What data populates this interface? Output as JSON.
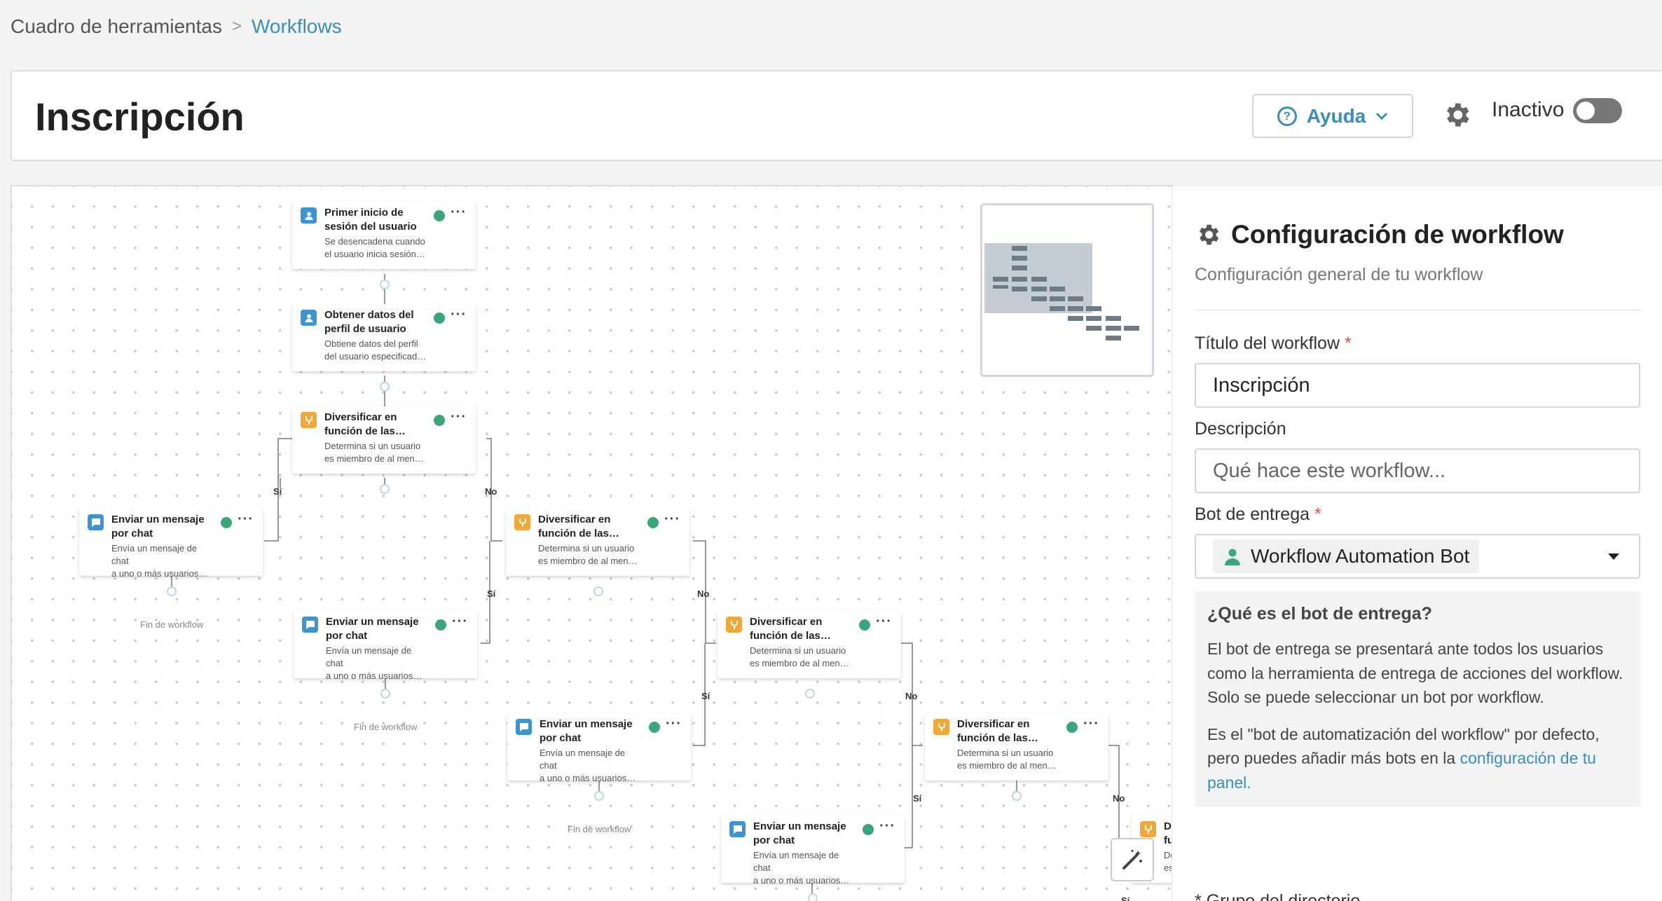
{
  "breadcrumb": {
    "root": "Cuadro de herramientas",
    "separator": ">",
    "current": "Workflows"
  },
  "header": {
    "title": "Inscripción",
    "help_label": "Ayuda",
    "status_label": "Inactivo"
  },
  "canvas": {
    "nodes": [
      {
        "title": "Primer inicio de\nsesión del usuario",
        "desc": "Se desencadena cuando\nel usuario inicia sesión…"
      },
      {
        "title": "Obtener datos del\nperfil de usuario",
        "desc": "Obtiene datos del perfil\ndel usuario especificad…"
      },
      {
        "title": "Diversificar en\nfunción de las…",
        "desc": "Determina si un usuario\nes miembro de al men…"
      },
      {
        "title": "Enviar un mensaje\npor chat",
        "desc": "Envía un mensaje de chat\na uno o más usuarios…"
      },
      {
        "title": "Diversificar en\nfunción de las…",
        "desc": "Determina si un usuario\nes miembro de al men…"
      },
      {
        "title": "Enviar un mensaje\npor chat",
        "desc": "Envía un mensaje de chat\na uno o más usuarios…"
      },
      {
        "title": "Diversificar en\nfunción de las…",
        "desc": "Determina si un usuario\nes miembro de al men…"
      },
      {
        "title": "Enviar un mensaje\npor chat",
        "desc": "Envía un mensaje de chat\na uno o más usuarios…"
      },
      {
        "title": "Diversificar en\nfunción de las…",
        "desc": "Determina si un usuario\nes miembro de al men…"
      },
      {
        "title": "Enviar un mensaje\npor chat",
        "desc": "Envía un mensaje de chat\na uno o más usuarios…"
      },
      {
        "title": "Div\nfun",
        "desc": "Del\nes r"
      }
    ],
    "yes_label": "Sí",
    "no_label": "No",
    "end_label": "Fin de workflow"
  },
  "panel": {
    "title": "Configuración de workflow",
    "subtitle": "Configuración general de tu workflow",
    "title_field_label": "Título del workflow",
    "title_field_value": "Inscripción",
    "required_mark": "*",
    "description_label": "Descripción",
    "description_placeholder": "Qué hace este workflow...",
    "bot_label": "Bot de entrega",
    "bot_value": "Workflow Automation Bot",
    "info_title": "¿Qué es el bot de entrega?",
    "info_p1": "El bot de entrega se presentará ante todos los usuarios como la herramienta de entrega de acciones del workflow. Solo se puede seleccionar un bot por workflow.",
    "info_p2_before": "Es el \"bot de automatización del workflow\" por defecto, pero puedes añadir más bots en la ",
    "info_link": "configuración de tu panel.",
    "next_label_partial": "Grupo del directorio"
  },
  "colors": {
    "accent": "#3a8eba",
    "success": "#3aa77b",
    "branch": "#f0a83a",
    "user": "#3c94d3",
    "required": "#d9534f"
  },
  "icons": [
    "question-circle-icon",
    "chevron-down-icon",
    "gear-icon",
    "toggle-switch",
    "user-icon",
    "branch-icon",
    "chat-icon",
    "check-circle-icon",
    "more-icon",
    "magic-wand-icon",
    "caret-down-icon",
    "avatar-icon"
  ]
}
